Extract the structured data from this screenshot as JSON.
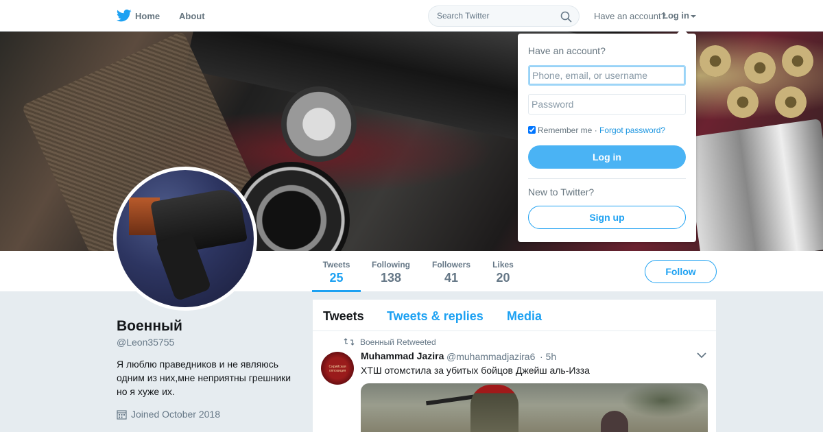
{
  "nav": {
    "home_label": "Home",
    "about_label": "About",
    "search_placeholder": "Search Twitter",
    "have_account": "Have an account?",
    "login_label": "Log in"
  },
  "colors": {
    "accent": "#1da1f2",
    "login_button": "#4ab3f4",
    "background": "#e6ecf0"
  },
  "profile": {
    "name": "Военный",
    "handle": "@Leon35755",
    "bio": "Я люблю праведников и не являюсь одним из них,мне неприятны грешники но я хуже их.",
    "joined": "Joined October 2018",
    "follow_label": "Follow"
  },
  "stats": [
    {
      "label": "Tweets",
      "value": "25",
      "active": true
    },
    {
      "label": "Following",
      "value": "138"
    },
    {
      "label": "Followers",
      "value": "41"
    },
    {
      "label": "Likes",
      "value": "20"
    }
  ],
  "timeline": {
    "tabs": [
      "Tweets",
      "Tweets & replies",
      "Media"
    ],
    "tweet": {
      "retweet_context": "Военный Retweeted",
      "author_name": "Muhammad Jazira",
      "author_handle": "@muhammadjazira6",
      "time": "· 5h",
      "text": "ХТШ отомстила за убитых бойцов Джейш аль-Изза",
      "avatar_caption": "Сирийская оппозиция"
    }
  },
  "login_dropdown": {
    "title": "Have an account?",
    "username_placeholder": "Phone, email, or username",
    "password_placeholder": "Password",
    "remember_label": "Remember me",
    "separator": " · ",
    "forgot_label": "Forgot password?",
    "login_button": "Log in",
    "new_label": "New to Twitter?",
    "signup_button": "Sign up"
  }
}
